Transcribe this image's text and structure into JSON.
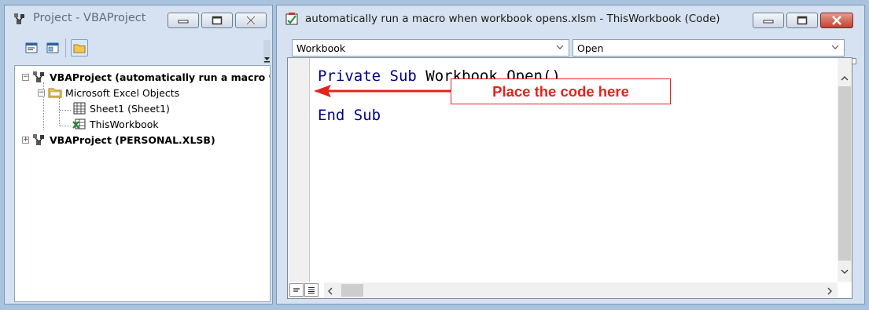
{
  "project_window": {
    "title": "Project - VBAProject",
    "tree": [
      {
        "label": "VBAProject (automatically run a macro wl",
        "bold": true,
        "expander": "−"
      },
      {
        "label": "Microsoft Excel Objects",
        "expander": "−"
      },
      {
        "label": "Sheet1 (Sheet1)"
      },
      {
        "label": "ThisWorkbook"
      },
      {
        "label": "VBAProject (PERSONAL.XLSB)",
        "bold": true,
        "expander": "+"
      }
    ]
  },
  "code_window": {
    "title": "automatically run a macro when workbook opens.xlsm - ThisWorkbook (Code)",
    "object_combo": "Workbook",
    "procedure_combo": "Open",
    "code_lines": {
      "line1_kw": "Private Sub",
      "line1_rest": " Workbook_Open()",
      "line3": "End Sub"
    }
  },
  "annotation": {
    "text": "Place the code here",
    "color": "#e4231d"
  },
  "colors": {
    "keyword": "#00008b",
    "frame": "#d6e2f1",
    "desktop": "#a9c3de"
  },
  "icons": [
    "vba-project-icon",
    "minimize-icon",
    "maximize-icon",
    "close-icon",
    "view-code-icon",
    "view-object-icon",
    "toggle-folders-icon",
    "folder-icon",
    "worksheet-icon",
    "workbook-icon",
    "chevron-down-icon",
    "chevron-up-icon",
    "chevron-left-icon",
    "chevron-right-icon"
  ]
}
